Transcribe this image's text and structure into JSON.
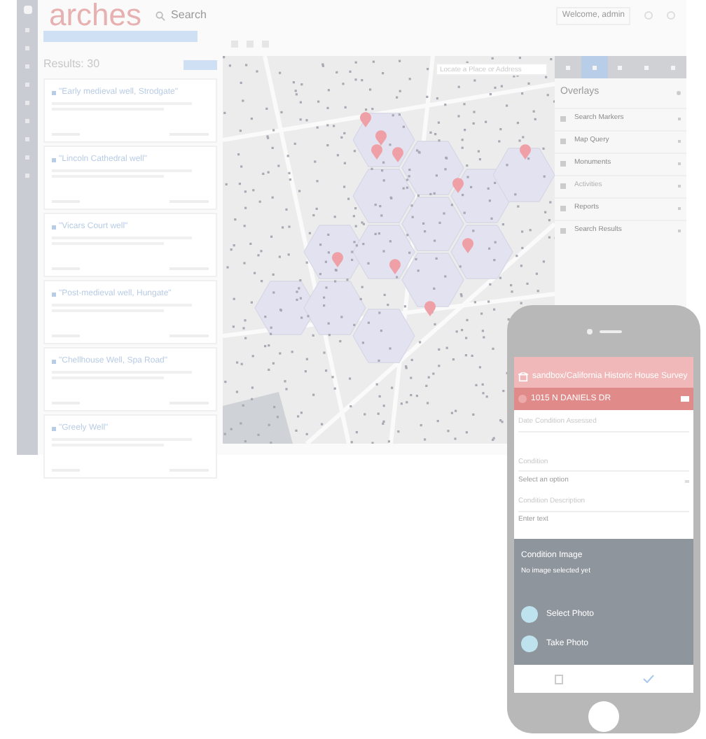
{
  "app": {
    "logo": "arches",
    "search_placeholder": "Search",
    "welcome": "Welcome, admin"
  },
  "sidebar": {
    "items": [
      {
        "selected": true
      },
      {
        "selected": false
      },
      {
        "selected": false
      },
      {
        "selected": false
      },
      {
        "selected": false
      },
      {
        "selected": false
      },
      {
        "selected": false
      },
      {
        "selected": false
      },
      {
        "selected": false
      },
      {
        "selected": false
      }
    ]
  },
  "results": {
    "count": "Results: 30",
    "items": [
      {
        "title": "\"Early medieval well, Strodgate\""
      },
      {
        "title": "\"Lincoln Cathedral well\""
      },
      {
        "title": "\"Vicars Court well\""
      },
      {
        "title": "\"Post-medieval well, Hungate\""
      },
      {
        "title": "\"Chellhouse Well, Spa Road\""
      },
      {
        "title": "\"Greely Well\""
      }
    ]
  },
  "map": {
    "locate_placeholder": "Locate a Place or Address",
    "tools": [
      {
        "selected": false
      },
      {
        "selected": true
      },
      {
        "selected": false
      },
      {
        "selected": false
      },
      {
        "selected": false
      }
    ]
  },
  "overlays": {
    "title": "Overlays",
    "items": [
      {
        "label": "Search Markers",
        "disabled": false
      },
      {
        "label": "Map Query",
        "disabled": false
      },
      {
        "label": "Monuments",
        "disabled": false
      },
      {
        "label": "Activities",
        "disabled": true
      },
      {
        "label": "Reports",
        "disabled": false
      },
      {
        "label": "Search Results",
        "disabled": false
      }
    ]
  },
  "phone": {
    "project": "sandbox/California Historic House Survey",
    "record": "1015 N DANIELS DR",
    "fields": [
      {
        "kind": "text",
        "label": "Date Condition Assessed"
      },
      {
        "kind": "select",
        "label": "Condition",
        "placeholder": "Select an option"
      },
      {
        "kind": "text",
        "label": "Condition Description",
        "placeholder": "Enter text"
      }
    ],
    "image_label": "Condition Image",
    "image_note": "No image selected yet",
    "actions": [
      {
        "label": "Select Photo"
      },
      {
        "label": "Take Photo"
      }
    ]
  }
}
